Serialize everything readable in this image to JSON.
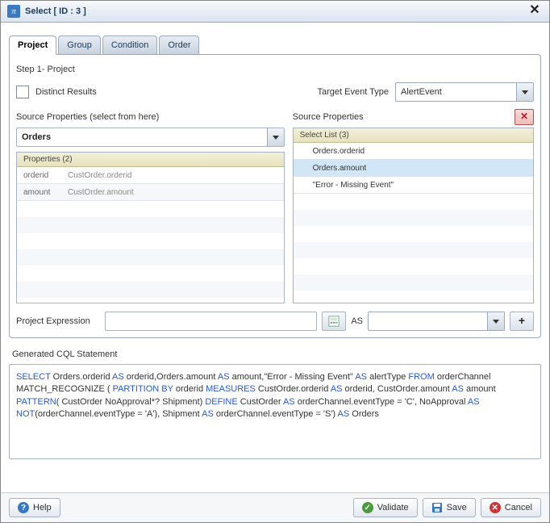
{
  "title": "Select [ ID : 3 ]",
  "pi_glyph": "π",
  "tabs": [
    "Project",
    "Group",
    "Condition",
    "Order"
  ],
  "step_label": "Step 1- Project",
  "distinct_label": "Distinct Results",
  "target_label": "Target Event Type",
  "target_value": "AlertEvent",
  "left": {
    "title": "Source Properties (select from here)",
    "combo": "Orders",
    "group": "Properties (2)",
    "rows": [
      {
        "k": "orderid",
        "v": "CustOrder.orderid"
      },
      {
        "k": "amount",
        "v": "CustOrder.amount"
      }
    ]
  },
  "right": {
    "title": "Source Properties",
    "group": "Select List (3)",
    "items": [
      "Orders.orderid",
      "Orders.amount",
      "\"Error - Missing Event\""
    ],
    "selected_index": 1
  },
  "expr": {
    "label": "Project Expression",
    "value": "",
    "as": "AS",
    "as_value": "",
    "plus": "+"
  },
  "gen_label": "Generated CQL Statement",
  "cql": {
    "t": [
      "SELECT",
      " Orders.orderid ",
      "AS",
      " orderid,Orders.amount ",
      "AS",
      " amount,\"Error - Missing Event\" ",
      "AS",
      " alertType ",
      "FROM",
      " orderChannel MATCH_RECOGNIZE ( ",
      "PARTITION BY",
      " orderid ",
      "MEASURES",
      " CustOrder.orderid ",
      "AS",
      " orderid, CustOrder.amount ",
      "AS",
      " amount ",
      "PATTERN",
      "( CustOrder NoApproval*? Shipment) ",
      "DEFINE",
      " CustOrder ",
      "AS",
      " orderChannel.eventType = 'C', NoApproval ",
      "AS NOT",
      "(orderChannel.eventType = 'A'), Shipment ",
      "AS",
      " orderChannel.eventType = 'S') ",
      "AS",
      " Orders"
    ],
    "kw": [
      0,
      2,
      4,
      6,
      8,
      10,
      12,
      14,
      16,
      18,
      20,
      22,
      24,
      26,
      28
    ]
  },
  "footer": {
    "help": "Help",
    "validate": "Validate",
    "save": "Save",
    "cancel": "Cancel"
  }
}
